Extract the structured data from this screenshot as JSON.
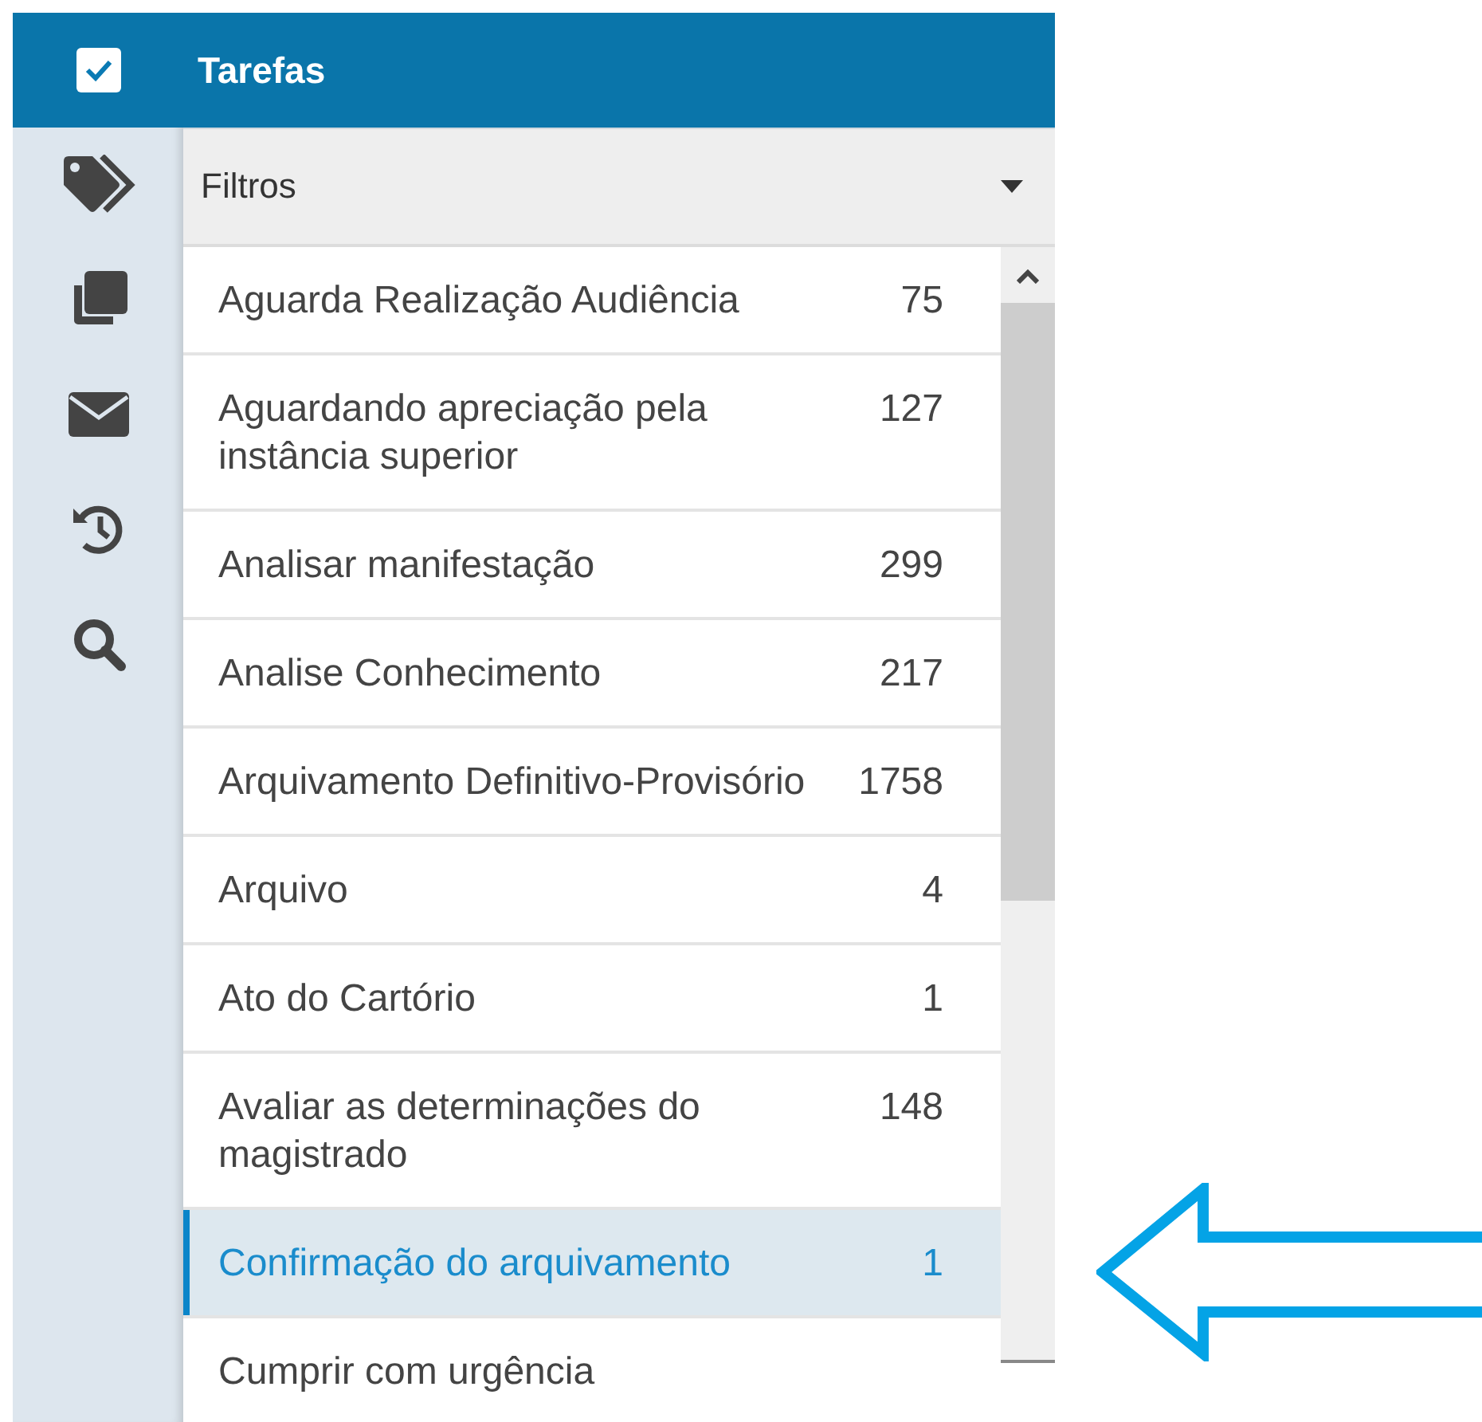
{
  "sidebar": {
    "items": [
      {
        "kind": "tasks",
        "selected": true
      },
      {
        "kind": "tags",
        "selected": false
      },
      {
        "kind": "copies",
        "selected": false
      },
      {
        "kind": "mail",
        "selected": false
      },
      {
        "kind": "history",
        "selected": false
      },
      {
        "kind": "search",
        "selected": false
      }
    ]
  },
  "panel": {
    "title": "Tarefas",
    "filter": {
      "label": "Filtros"
    },
    "rows": [
      {
        "label": "Aguarda Realização Audiência",
        "count": "75",
        "selected": false
      },
      {
        "label": "Aguardando apreciação pela instância superior",
        "count": "127",
        "selected": false
      },
      {
        "label": "Analisar manifestação",
        "count": "299",
        "selected": false
      },
      {
        "label": "Analise Conhecimento",
        "count": "217",
        "selected": false
      },
      {
        "label": "Arquivamento Definitivo-Provisório",
        "count": "1758",
        "selected": false
      },
      {
        "label": "Arquivo",
        "count": "4",
        "selected": false
      },
      {
        "label": "Ato do Cartório",
        "count": "1",
        "selected": false
      },
      {
        "label": "Avaliar as determinações do magistrado",
        "count": "148",
        "selected": false
      },
      {
        "label": "Confirmação do arquivamento",
        "count": "1",
        "selected": true
      },
      {
        "label": "Cumprir com urgência",
        "selected": false
      }
    ]
  },
  "annotation": {
    "kind": "arrow"
  }
}
